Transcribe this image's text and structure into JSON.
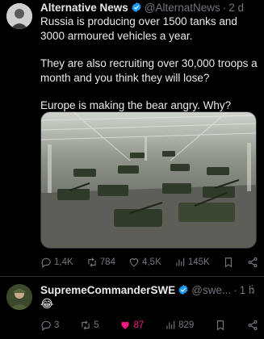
{
  "tweet": {
    "author_name": "Alternative News",
    "handle": "@AlternatNews",
    "separator": "·",
    "time": "2 d",
    "paragraphs": [
      "Russia is producing over 1500 tanks and 3000 armoured vehicles a year.",
      "They are also recruiting over 30,000 troops a month and you think they will lose?",
      "Europe is making the bear angry. Why?"
    ],
    "stats": {
      "replies": "1,4K",
      "retweets": "784",
      "likes": "4,5K",
      "views": "145K"
    }
  },
  "reply": {
    "author_name": "SupremeCommanderSWE",
    "handle": "@swe...",
    "separator": "·",
    "time": "1 h",
    "text": "😂",
    "stats": {
      "replies": "3",
      "retweets": "5",
      "likes": "87",
      "views": "829"
    }
  },
  "colors": {
    "verified": "#1d9bf0",
    "liked": "#f91880",
    "muted": "#71767b"
  }
}
